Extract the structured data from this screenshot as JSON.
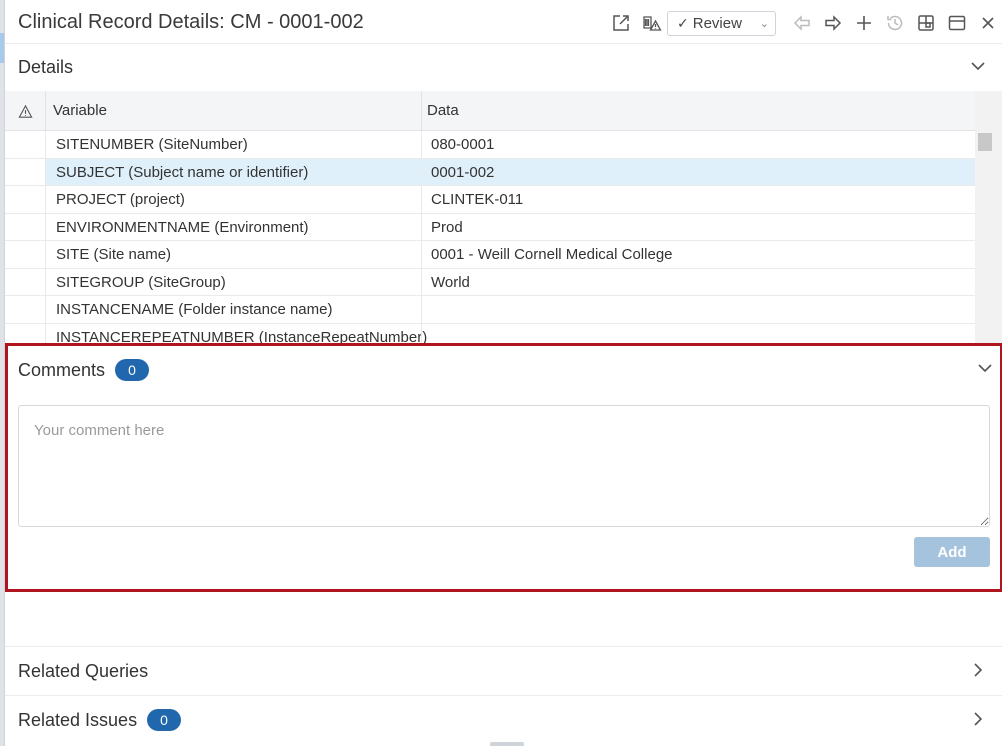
{
  "window": {
    "title": "Clinical Record Details: CM - 0001-002"
  },
  "toolbar": {
    "review_label": "Review",
    "icons": [
      "open-external-icon",
      "flag-warning-icon",
      "back-arrow-icon",
      "forward-arrow-icon",
      "plus-icon",
      "history-icon",
      "layout-icon",
      "panel-icon",
      "close-icon"
    ]
  },
  "details": {
    "title": "Details",
    "columns": {
      "variable": "Variable",
      "data": "Data"
    },
    "rows": [
      {
        "variable": "SITENUMBER (SiteNumber)",
        "data": "080-0001"
      },
      {
        "variable": "SUBJECT (Subject name or identifier)",
        "data": "0001-002"
      },
      {
        "variable": "PROJECT (project)",
        "data": "CLINTEK-011"
      },
      {
        "variable": "ENVIRONMENTNAME (Environment)",
        "data": "Prod"
      },
      {
        "variable": "SITE (Site name)",
        "data": "0001 - Weill Cornell Medical College"
      },
      {
        "variable": "SITEGROUP (SiteGroup)",
        "data": "World"
      },
      {
        "variable": "INSTANCENAME (Folder instance name)",
        "data": ""
      },
      {
        "variable": "INSTANCEREPEATNUMBER (InstanceRepeatNumber)",
        "data": ""
      }
    ]
  },
  "comments": {
    "title": "Comments",
    "count": "0",
    "placeholder": "Your comment here",
    "add_label": "Add"
  },
  "related_queries": {
    "title": "Related Queries"
  },
  "related_issues": {
    "title": "Related Issues",
    "count": "0"
  },
  "colors": {
    "accent": "#2167ae",
    "highlight_border": "#b0141c",
    "selected_row": "#e0f0fb",
    "add_button_disabled": "#a5c3dc"
  }
}
